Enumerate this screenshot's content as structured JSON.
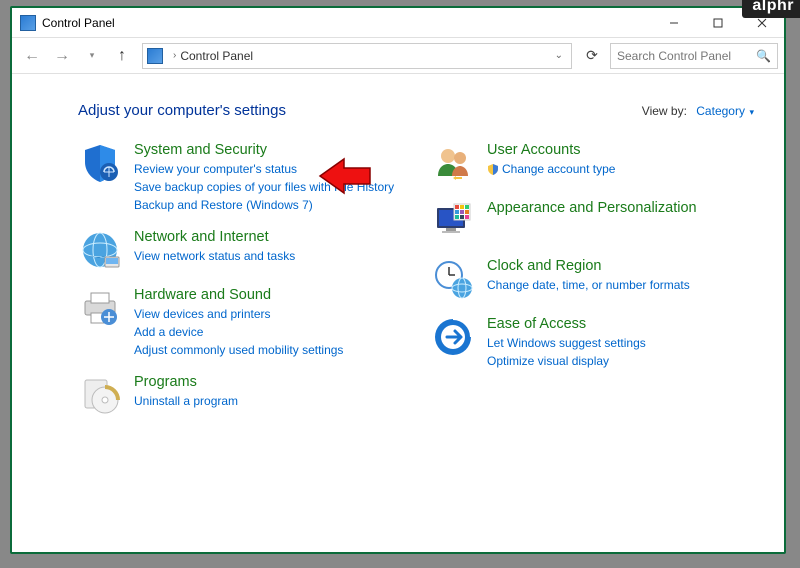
{
  "titlebar": {
    "title": "Control Panel"
  },
  "navbar": {
    "path_label": "Control Panel",
    "search_placeholder": "Search Control Panel"
  },
  "header": {
    "title": "Adjust your computer's settings",
    "viewby_label": "View by:",
    "viewby_value": "Category"
  },
  "left_column": [
    {
      "title": "System and Security",
      "subs": [
        "Review your computer's status",
        "Save backup copies of your files with File History",
        "Backup and Restore (Windows 7)"
      ]
    },
    {
      "title": "Network and Internet",
      "subs": [
        "View network status and tasks"
      ]
    },
    {
      "title": "Hardware and Sound",
      "subs": [
        "View devices and printers",
        "Add a device",
        "Adjust commonly used mobility settings"
      ]
    },
    {
      "title": "Programs",
      "subs": [
        "Uninstall a program"
      ]
    }
  ],
  "right_column": [
    {
      "title": "User Accounts",
      "subs": [
        "Change account type"
      ]
    },
    {
      "title": "Appearance and Personalization",
      "subs": []
    },
    {
      "title": "Clock and Region",
      "subs": [
        "Change date, time, or number formats"
      ]
    },
    {
      "title": "Ease of Access",
      "subs": [
        "Let Windows suggest settings",
        "Optimize visual display"
      ]
    }
  ],
  "watermark": "alphr"
}
